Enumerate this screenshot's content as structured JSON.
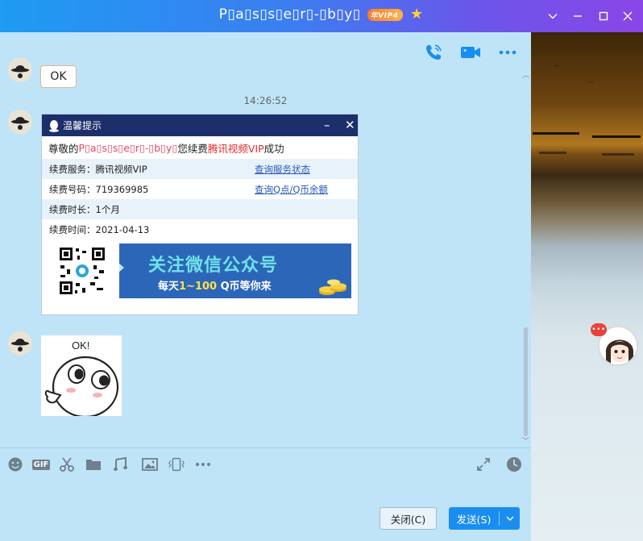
{
  "window": {
    "title": "P▯a▯s▯s▯e▯r▯-▯b▯y▯",
    "vip_badge": "年VIP4"
  },
  "chat": {
    "ok_text": "OK",
    "timestamp": "14:26:52",
    "card": {
      "header_title": "温馨提示",
      "intro_prefix": "尊敬的 ",
      "intro_name": "P▯a▯s▯s▯e▯r▯-▯b▯y▯",
      "intro_mid": " 您续费",
      "intro_product": "腾讯视频VIP",
      "intro_suffix": "成功",
      "rows": [
        {
          "label": "续费服务：",
          "value": "腾讯视频VIP",
          "link": "查询服务状态"
        },
        {
          "label": "续费号码：",
          "value": "719369985",
          "link": "查询Q点/Q币余额"
        },
        {
          "label": "续费时长：",
          "value": "1个月",
          "link": ""
        },
        {
          "label": "续费时间：",
          "value": "2021-04-13",
          "link": ""
        }
      ],
      "banner_title": "关注微信公众号",
      "banner_sub_prefix": "每天",
      "banner_sub_highlight": "1~100",
      "banner_sub_suffix": " Q币等你来"
    },
    "sticker_text": "OK!"
  },
  "buttons": {
    "close": "关闭(C)",
    "send": "发送(S)"
  },
  "colors": {
    "accent": "#1a8ef0",
    "header_dark": "#1c2f6b",
    "chat_bg": "#bfe4f7",
    "highlight_red": "#e42a2a"
  }
}
